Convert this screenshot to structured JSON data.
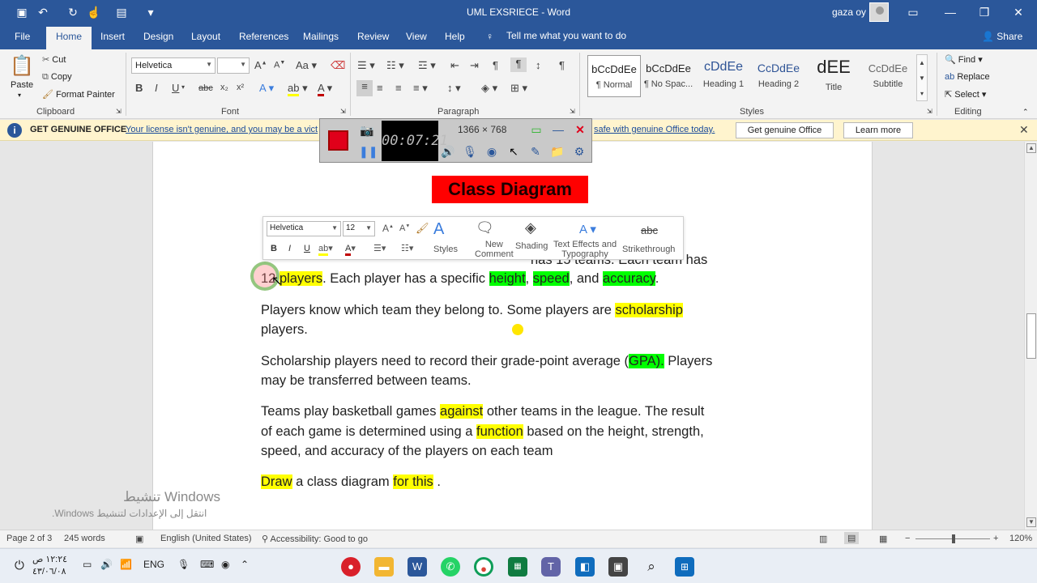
{
  "titlebar": {
    "title": "UML EXSRIECE  -  Word",
    "user": "gaza oy"
  },
  "tabs": [
    "File",
    "Home",
    "Insert",
    "Design",
    "Layout",
    "References",
    "Mailings",
    "Review",
    "View",
    "Help"
  ],
  "tellme": "Tell me what you want to do",
  "share": "Share",
  "clipboard": {
    "paste": "Paste",
    "cut": "Cut",
    "copy": "Copy",
    "format_painter": "Format Painter",
    "label": "Clipboard"
  },
  "font": {
    "name": "Helvetica",
    "size": "",
    "label": "Font",
    "bold": "B",
    "italic": "I",
    "underline": "U",
    "strike": "abc",
    "subscript": "x₂",
    "superscript": "x²",
    "grow": "A",
    "shrink": "A",
    "case": "Aa"
  },
  "paragraph_label": "Paragraph",
  "styles": {
    "label": "Styles",
    "items": [
      {
        "sample": "bCcDdEe",
        "name": "¶ Normal"
      },
      {
        "sample": "bCcDdEe",
        "name": "¶ No Spac..."
      },
      {
        "sample": "cDdEe",
        "name": "Heading 1"
      },
      {
        "sample": "CcDdEe",
        "name": "Heading 2"
      },
      {
        "sample": "dEE",
        "name": "Title"
      },
      {
        "sample": "CcDdEe",
        "name": "Subtitle"
      }
    ]
  },
  "editing": {
    "find": "Find",
    "replace": "Replace",
    "select": "Select",
    "label": "Editing"
  },
  "message": {
    "title": "GET GENUINE OFFICE",
    "text_left": "Your license isn't genuine, and you may be a vict",
    "text_right": "safe with genuine Office today.",
    "btn_genuine": "Get genuine Office",
    "btn_learn": "Learn more"
  },
  "recorder": {
    "time": "00:07:21",
    "resolution": "1366 × 768"
  },
  "minibar": {
    "font": "Helvetica",
    "size": "12",
    "styles": "Styles",
    "new_comment_1": "New",
    "new_comment_2": "Comment",
    "shading": "Shading",
    "text_effects_1": "Text Effects and",
    "text_effects_2": "Typography",
    "strike_sample": "abc",
    "strikethrough": "Strikethrough"
  },
  "doc": {
    "title": "Class Diagram",
    "line1_pre": "12 ",
    "line1_players": "players",
    "line1_mid": ". Each player has a specific ",
    "line1_height": "height",
    "line1_comma1": ", ",
    "line1_speed": "speed",
    "line1_and": ", and ",
    "line1_accuracy": "accuracy",
    "line1_end": ".",
    "line0_tail": "has 15 teams. Each team has",
    "p2_pre": " Players know which team they belong to. Some players are ",
    "p2_scholarship": "scholarship",
    "p2_line2": "players.",
    "p3_pre": "Scholarship players need to record their grade-point average (",
    "p3_gpa": "GPA).",
    "p3_post": " Players",
    "p3_line2": "may be transferred between teams.",
    "p4_pre": " Teams play basketball games ",
    "p4_against": "against",
    "p4_post": " other teams in the league. The result",
    "p4_l2_pre": "of each game is determined using a ",
    "p4_function": "function",
    "p4_l2_post": " based on the height, strength,",
    "p4_line3": "speed, and accuracy of the players on each team",
    "p5_sp": " ",
    "p5_draw": "Draw",
    "p5_mid": " a class diagram ",
    "p5_for": "for this",
    "p5_end": " ."
  },
  "watermark": {
    "line1": "Windows تنشيط",
    "line2": "انتقل إلى الإعدادات لتنشيط Windows."
  },
  "status": {
    "page": "Page 2 of 3",
    "words": "245 words",
    "language": "English (United States)",
    "accessibility": "Accessibility: Good to go",
    "zoom": "120%"
  },
  "taskbar": {
    "lang": "ENG",
    "time": "١٢:٢٤ ص",
    "date": "٤٣/٠٦/٠٨"
  },
  "colors": {
    "word_blue": "#2b579a",
    "highlight_yellow": "#ffff00",
    "highlight_green": "#00ff00",
    "title_red": "#ff0000"
  }
}
